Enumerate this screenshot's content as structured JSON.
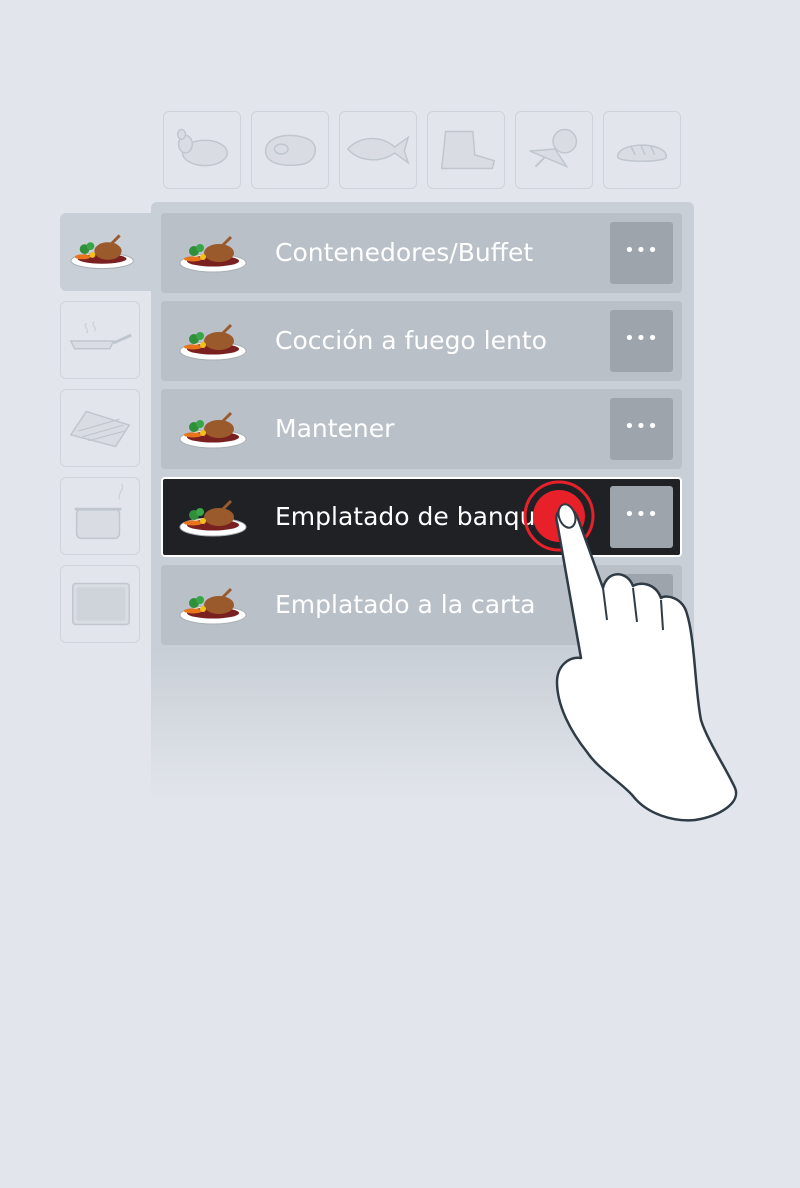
{
  "categories": [
    {
      "icon": "poultry-icon"
    },
    {
      "icon": "meat-icon"
    },
    {
      "icon": "fish-icon"
    },
    {
      "icon": "bakery-product-icon"
    },
    {
      "icon": "vegetables-icon"
    },
    {
      "icon": "bread-icon"
    }
  ],
  "methods": [
    {
      "icon": "finishing-plate-icon",
      "active": true
    },
    {
      "icon": "pan-frying-icon"
    },
    {
      "icon": "grill-icon"
    },
    {
      "icon": "steam-pot-icon"
    },
    {
      "icon": "oven-icon"
    }
  ],
  "list": {
    "items": [
      {
        "label": "Contenedores/Buffet",
        "icon": "plate-icon",
        "more": "•••"
      },
      {
        "label": "Cocción a fuego lento",
        "icon": "plate-icon",
        "more": "•••"
      },
      {
        "label": "Mantener",
        "icon": "plate-icon",
        "more": "•••"
      },
      {
        "label": "Emplatado de banquete",
        "icon": "plate-icon",
        "more": "•••",
        "selected": true
      },
      {
        "label": "Emplatado a la carta",
        "icon": "plate-icon",
        "more": "•••"
      }
    ]
  },
  "overlay": {
    "gesture": "tap",
    "icon": "pointing-hand-icon"
  },
  "colors": {
    "background": "#e2e6ec",
    "panel": "#c9cfd6",
    "row": "#b9c0c8",
    "row_selected": "#1f2124",
    "tap_indicator": "#e8202a"
  }
}
